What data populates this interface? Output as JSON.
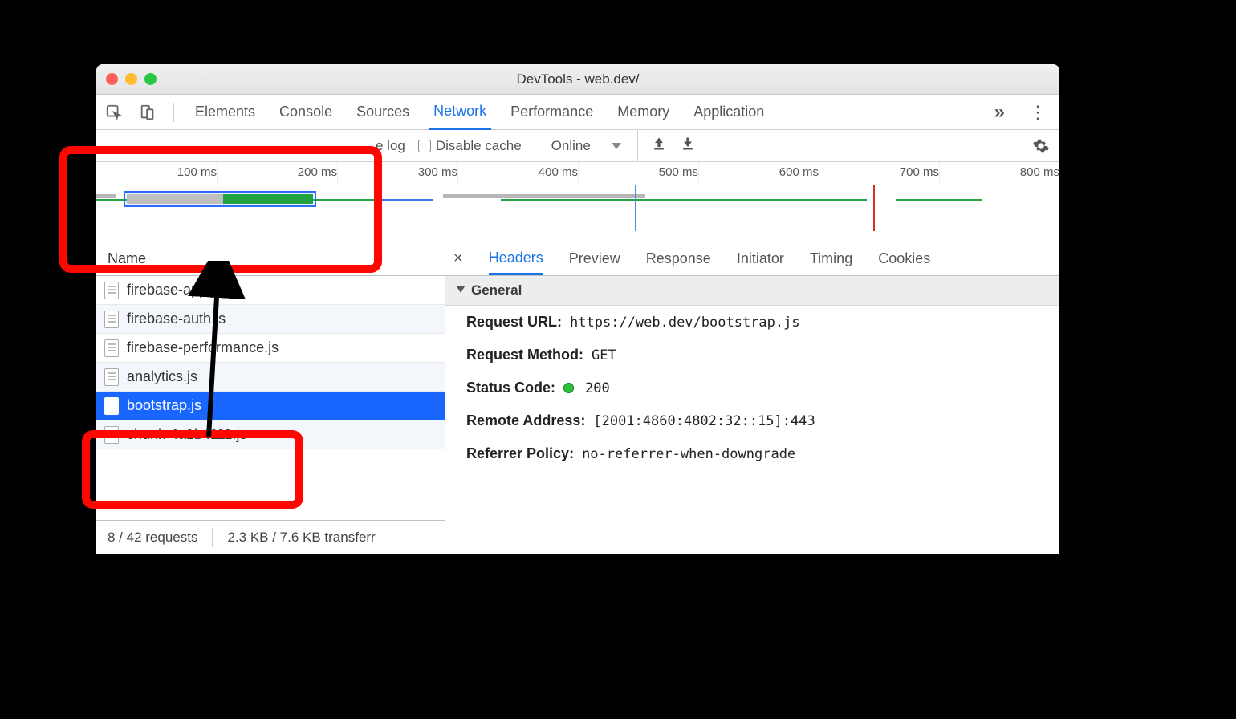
{
  "window": {
    "title": "DevTools - web.dev/"
  },
  "menu": {
    "tabs": [
      "Elements",
      "Console",
      "Sources",
      "Network",
      "Performance",
      "Memory",
      "Application"
    ],
    "active": 3
  },
  "toolbar": {
    "preserve_log": "e log",
    "disable_cache": "Disable cache",
    "throttle": "Online"
  },
  "timeline": {
    "marks": [
      "100 ms",
      "200 ms",
      "300 ms",
      "400 ms",
      "500 ms",
      "600 ms",
      "700 ms",
      "800 ms"
    ]
  },
  "list": {
    "header": "Name",
    "rows": [
      {
        "name": "firebase-app.js"
      },
      {
        "name": "firebase-auth.js"
      },
      {
        "name": "firebase-performance.js"
      },
      {
        "name": "analytics.js"
      },
      {
        "name": "bootstrap.js",
        "selected": true
      },
      {
        "name": "chunk-4a1b4111.js"
      }
    ]
  },
  "status": {
    "requests": "8 / 42 requests",
    "transfer": "2.3 KB / 7.6 KB transferr"
  },
  "detail_tabs": [
    "Headers",
    "Preview",
    "Response",
    "Initiator",
    "Timing",
    "Cookies"
  ],
  "detail_active": 0,
  "general": {
    "title": "General",
    "request_url_k": "Request URL:",
    "request_url_v": "https://web.dev/bootstrap.js",
    "method_k": "Request Method:",
    "method_v": "GET",
    "status_k": "Status Code:",
    "status_v": "200",
    "remote_k": "Remote Address:",
    "remote_v": "[2001:4860:4802:32::15]:443",
    "referrer_k": "Referrer Policy:",
    "referrer_v": "no-referrer-when-downgrade"
  }
}
